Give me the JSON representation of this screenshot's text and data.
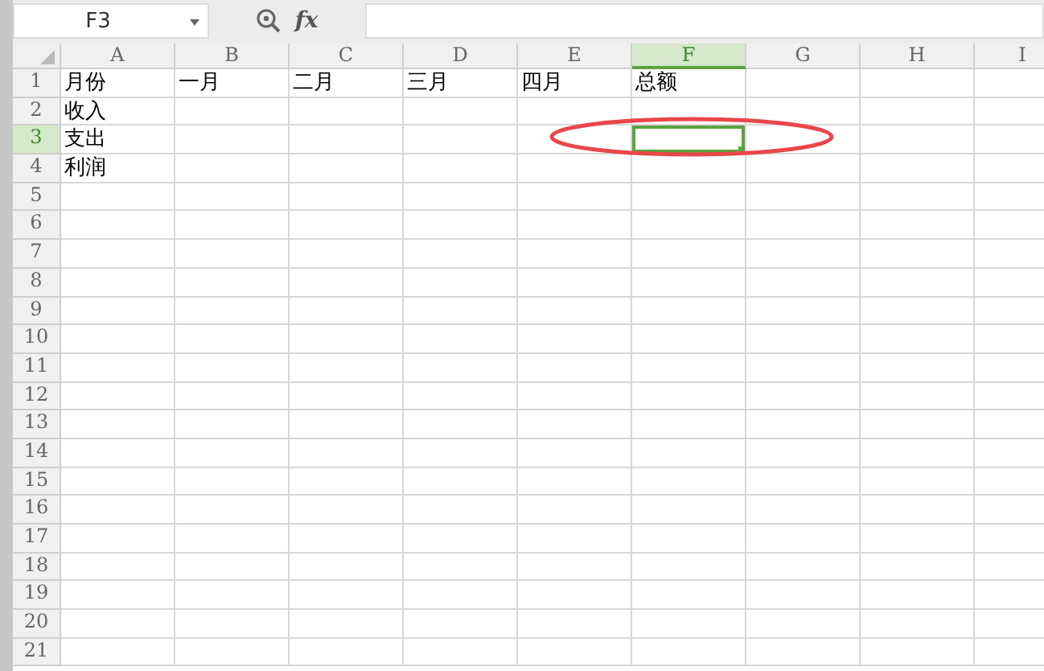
{
  "formula_bar": {
    "name_box": "F3",
    "function_label": "fx"
  },
  "columns": [
    {
      "label": "A",
      "selected": false
    },
    {
      "label": "B",
      "selected": false
    },
    {
      "label": "C",
      "selected": false
    },
    {
      "label": "D",
      "selected": false
    },
    {
      "label": "E",
      "selected": false
    },
    {
      "label": "F",
      "selected": true
    },
    {
      "label": "G",
      "selected": false
    },
    {
      "label": "H",
      "selected": false
    },
    {
      "label": "I",
      "selected": false
    }
  ],
  "rows": [
    {
      "label": "1",
      "selected": false,
      "cells": [
        "月份",
        "一月",
        "二月",
        "三月",
        "四月",
        "总额"
      ]
    },
    {
      "label": "2",
      "selected": false,
      "cells": [
        "收入"
      ]
    },
    {
      "label": "3",
      "selected": true,
      "cells": [
        "支出"
      ]
    },
    {
      "label": "4",
      "selected": false,
      "cells": [
        "利润"
      ]
    },
    {
      "label": "5",
      "selected": false
    },
    {
      "label": "6",
      "selected": false
    },
    {
      "label": "7",
      "selected": false
    },
    {
      "label": "8",
      "selected": false
    },
    {
      "label": "9",
      "selected": false
    },
    {
      "label": "10",
      "selected": false
    },
    {
      "label": "11",
      "selected": false
    },
    {
      "label": "12",
      "selected": false
    },
    {
      "label": "13",
      "selected": false
    },
    {
      "label": "14",
      "selected": false
    },
    {
      "label": "15",
      "selected": false
    },
    {
      "label": "16",
      "selected": false
    },
    {
      "label": "17",
      "selected": false
    },
    {
      "label": "18",
      "selected": false
    },
    {
      "label": "19",
      "selected": false
    },
    {
      "label": "20",
      "selected": false
    },
    {
      "label": "21",
      "selected": false
    }
  ]
}
